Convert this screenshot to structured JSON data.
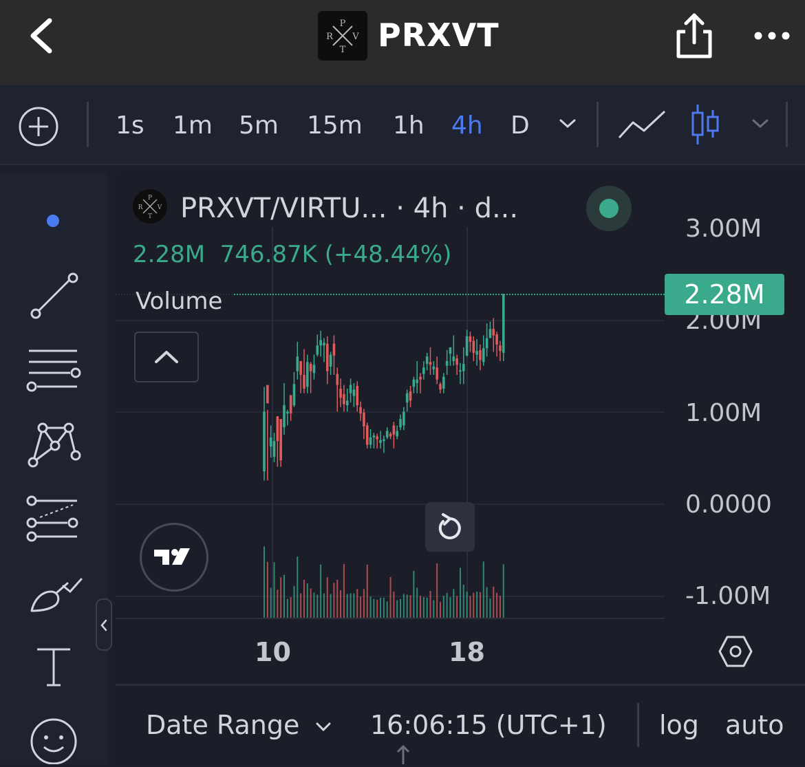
{
  "header": {
    "title": "PRXVT",
    "logo_letters": "PRVT"
  },
  "toolbar": {
    "timeframes": [
      {
        "label": "1s",
        "active": false
      },
      {
        "label": "1m",
        "active": false
      },
      {
        "label": "5m",
        "active": false
      },
      {
        "label": "15m",
        "active": false
      },
      {
        "label": "1h",
        "active": false
      },
      {
        "label": "4h",
        "active": true
      },
      {
        "label": "D",
        "active": false
      }
    ]
  },
  "legend": {
    "title": "PRXVT/VIRTU... · 4h · d...",
    "last": "2.28M",
    "change": "746.87K (+48.44%)",
    "volume_label": "Volume"
  },
  "price_tag": "2.28M",
  "colors": {
    "up": "#3aa98c",
    "down": "#e05b5b",
    "accent": "#4c7bf0",
    "bg": "#1b1e29"
  },
  "chart_data": {
    "type": "candlestick",
    "x_ticks": [
      "10",
      "18"
    ],
    "y_ticks": [
      "3.00M",
      "2.00M",
      "1.00M",
      "0.0000",
      "-1.00M"
    ],
    "ylim": [
      -1000000,
      3000000
    ],
    "last_price": 2280000,
    "candles": [
      [
        0.35,
        1.0,
        0.25,
        1.27
      ],
      [
        1.29,
        1.09,
        0.25,
        1.02
      ],
      [
        0.62,
        0.72,
        0.5,
        0.85
      ],
      [
        0.51,
        0.68,
        0.45,
        0.77
      ],
      [
        0.95,
        0.68,
        0.4,
        0.72
      ],
      [
        0.92,
        0.47,
        0.4,
        0.92
      ],
      [
        0.83,
        1.07,
        0.75,
        1.31
      ],
      [
        0.98,
        1.0,
        0.85,
        1.02
      ],
      [
        1.18,
        0.98,
        0.9,
        1.1
      ],
      [
        1.07,
        1.3,
        1.05,
        1.43
      ],
      [
        1.44,
        1.6,
        1.35,
        1.76
      ],
      [
        1.55,
        1.4,
        1.2,
        1.46
      ],
      [
        1.4,
        1.25,
        1.2,
        1.68
      ],
      [
        1.27,
        1.54,
        1.2,
        1.62
      ],
      [
        1.52,
        1.44,
        1.2,
        1.54
      ],
      [
        1.42,
        1.51,
        1.35,
        1.62
      ],
      [
        1.62,
        1.72,
        1.6,
        1.84
      ],
      [
        1.72,
        1.78,
        1.6,
        1.88
      ],
      [
        1.72,
        1.75,
        1.54,
        1.8
      ],
      [
        1.74,
        1.44,
        1.3,
        1.82
      ],
      [
        1.49,
        1.62,
        1.4,
        1.65
      ],
      [
        1.74,
        1.61,
        1.4,
        1.83
      ],
      [
        1.41,
        1.29,
        1.0,
        1.48
      ],
      [
        1.25,
        1.15,
        1.05,
        1.36
      ],
      [
        1.19,
        1.08,
        1.0,
        1.29
      ],
      [
        1.07,
        1.12,
        1.0,
        1.25
      ],
      [
        1.2,
        1.29,
        1.1,
        1.36
      ],
      [
        1.17,
        1.24,
        1.05,
        1.31
      ],
      [
        1.28,
        1.07,
        1.0,
        1.33
      ],
      [
        1.05,
        0.98,
        0.9,
        1.11
      ],
      [
        0.99,
        0.84,
        0.7,
        1.03
      ],
      [
        0.85,
        0.64,
        0.6,
        0.88
      ],
      [
        0.64,
        0.72,
        0.6,
        0.81
      ],
      [
        0.72,
        0.74,
        0.6,
        0.77
      ],
      [
        0.73,
        0.7,
        0.6,
        0.76
      ],
      [
        0.66,
        0.69,
        0.6,
        0.79
      ],
      [
        0.68,
        0.7,
        0.55,
        0.74
      ],
      [
        0.72,
        0.79,
        0.7,
        0.83
      ],
      [
        0.76,
        0.73,
        0.7,
        0.78
      ],
      [
        0.85,
        0.75,
        0.6,
        0.89
      ],
      [
        0.73,
        0.79,
        0.7,
        0.85
      ],
      [
        0.83,
        0.92,
        0.8,
        0.97
      ],
      [
        0.85,
        1.0,
        0.8,
        1.05
      ],
      [
        1.1,
        1.2,
        1.0,
        1.24
      ],
      [
        1.22,
        1.12,
        1.05,
        1.28
      ],
      [
        1.27,
        1.35,
        1.2,
        1.38
      ],
      [
        1.31,
        1.35,
        1.2,
        1.55
      ],
      [
        1.38,
        1.35,
        1.2,
        1.42
      ],
      [
        1.41,
        1.48,
        1.35,
        1.55
      ],
      [
        1.52,
        1.6,
        1.45,
        1.64
      ],
      [
        1.54,
        1.51,
        1.4,
        1.7
      ],
      [
        1.46,
        1.49,
        1.4,
        1.55
      ],
      [
        1.48,
        1.35,
        1.3,
        1.6
      ],
      [
        1.3,
        1.24,
        1.2,
        1.32
      ],
      [
        1.25,
        1.38,
        1.2,
        1.42
      ],
      [
        1.5,
        1.55,
        1.4,
        1.67
      ],
      [
        1.63,
        1.7,
        1.5,
        1.7
      ],
      [
        1.55,
        1.6,
        1.5,
        1.83
      ],
      [
        1.58,
        1.51,
        1.4,
        1.62
      ],
      [
        1.44,
        1.45,
        1.3,
        1.53
      ],
      [
        1.44,
        1.52,
        1.3,
        1.7
      ],
      [
        1.61,
        1.82,
        1.6,
        1.89
      ],
      [
        1.82,
        1.76,
        1.65,
        1.87
      ],
      [
        1.77,
        1.64,
        1.55,
        1.82
      ],
      [
        1.62,
        1.66,
        1.5,
        1.79
      ],
      [
        1.67,
        1.56,
        1.45,
        1.73
      ],
      [
        1.54,
        1.69,
        1.5,
        1.83
      ],
      [
        1.69,
        1.8,
        1.6,
        1.96
      ],
      [
        1.8,
        1.9,
        1.8,
        1.98
      ],
      [
        1.9,
        1.83,
        1.65,
        2.02
      ],
      [
        1.84,
        1.73,
        1.6,
        1.87
      ],
      [
        1.72,
        1.66,
        1.55,
        1.77
      ],
      [
        1.64,
        2.28,
        1.55,
        2.28
      ]
    ]
  }
}
